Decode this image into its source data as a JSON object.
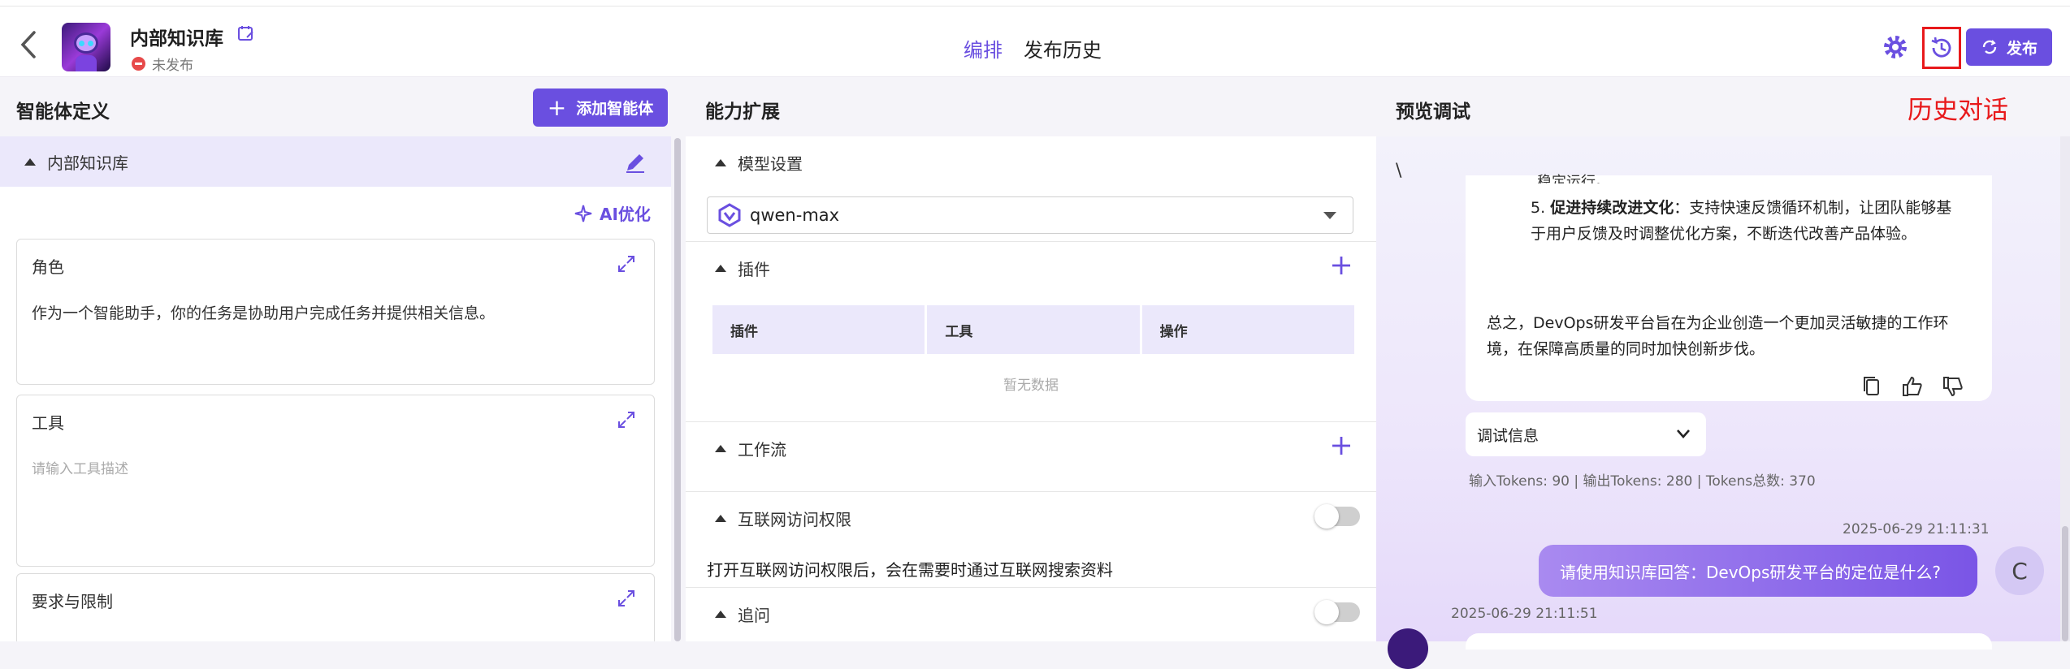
{
  "header": {
    "app_name": "内部知识库",
    "status": "未发布",
    "tabs": [
      {
        "label": "编排",
        "active": true
      },
      {
        "label": "发布历史",
        "active": false
      }
    ],
    "publish_label": "发布",
    "accent_color": "#6a4fe0"
  },
  "annotation": {
    "label": "历史对话",
    "color": "#e8191b"
  },
  "left": {
    "title": "智能体定义",
    "add_agent_label": "添加智能体",
    "kb_name": "内部知识库",
    "ai_optimize_label": "AI优化",
    "role": {
      "label": "角色",
      "text": "作为一个智能助手，你的任务是协助用户完成任务并提供相关信息。"
    },
    "tools": {
      "label": "工具",
      "placeholder": "请输入工具描述"
    },
    "limits": {
      "label": "要求与限制"
    }
  },
  "middle": {
    "title": "能力扩展",
    "model_section": "模型设置",
    "model_value": "qwen-max",
    "plugins_section": "插件",
    "plugin_headers": [
      "插件",
      "工具",
      "操作"
    ],
    "empty_text": "暂无数据",
    "workflow_section": "工作流",
    "internet_section": "互联网访问权限",
    "internet_desc": "打开互联网访问权限后，会在需要时通过互联网搜索资料",
    "followup_section": "追问"
  },
  "right": {
    "title": "预览调试",
    "backslash": "\\",
    "partial_text": "稳定运行。",
    "item_number": "5.",
    "item_title": "促进持续改进文化",
    "item_text": "：支持快速反馈循环机制，让团队能够基于用户反馈及时调整优化方案，不断迭代改善产品体验。",
    "summary": "总之，DevOps研发平台旨在为企业创造一个更加灵活敏捷的工作环境，在保障高质量的同时加快创新步伐。",
    "debug_label": "调试信息",
    "tokens": "输入Tokens: 90 |   输出Tokens: 280 |   Tokens总数: 370",
    "user_timestamp": "2025-06-29 21:11:31",
    "user_message": "请使用知识库回答：DevOps研发平台的定位是什么?",
    "user_avatar": "C",
    "bot_timestamp": "2025-06-29 21:11:51"
  }
}
